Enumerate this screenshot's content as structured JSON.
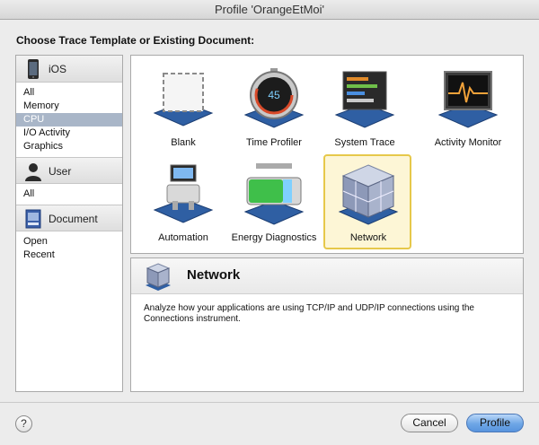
{
  "window": {
    "title": "Profile 'OrangeEtMoi'"
  },
  "heading": "Choose Trace Template or Existing Document:",
  "sidebar": {
    "sections": [
      {
        "label": "iOS",
        "icon": "iphone-icon",
        "items": [
          "All",
          "Memory",
          "CPU",
          "I/O Activity",
          "Graphics"
        ],
        "selected": "CPU"
      },
      {
        "label": "User",
        "icon": "user-silhouette-icon",
        "items": [
          "All"
        ]
      },
      {
        "label": "Document",
        "icon": "trace-document-icon",
        "items": [
          "Open",
          "Recent"
        ]
      }
    ]
  },
  "templates": [
    {
      "label": "Blank",
      "icon": "blank-template-icon"
    },
    {
      "label": "Time Profiler",
      "icon": "stopwatch-icon",
      "dial_text": "45"
    },
    {
      "label": "System Trace",
      "icon": "system-trace-icon"
    },
    {
      "label": "Activity Monitor",
      "icon": "activity-monitor-icon"
    },
    {
      "label": "Automation",
      "icon": "automation-robot-icon"
    },
    {
      "label": "Energy Diagnostics",
      "icon": "battery-icon"
    },
    {
      "label": "Network",
      "icon": "network-cube-icon",
      "selected": true
    }
  ],
  "detail": {
    "title": "Network",
    "icon": "network-cube-icon",
    "description": "Analyze how your applications are using TCP/IP and UDP/IP connections using the Connections instrument."
  },
  "buttons": {
    "help": "?",
    "cancel": "Cancel",
    "profile": "Profile"
  },
  "colors": {
    "selection": "#a9b6c8",
    "primary_button": "#6ea6e6",
    "tile_highlight": "#e6c84a"
  }
}
